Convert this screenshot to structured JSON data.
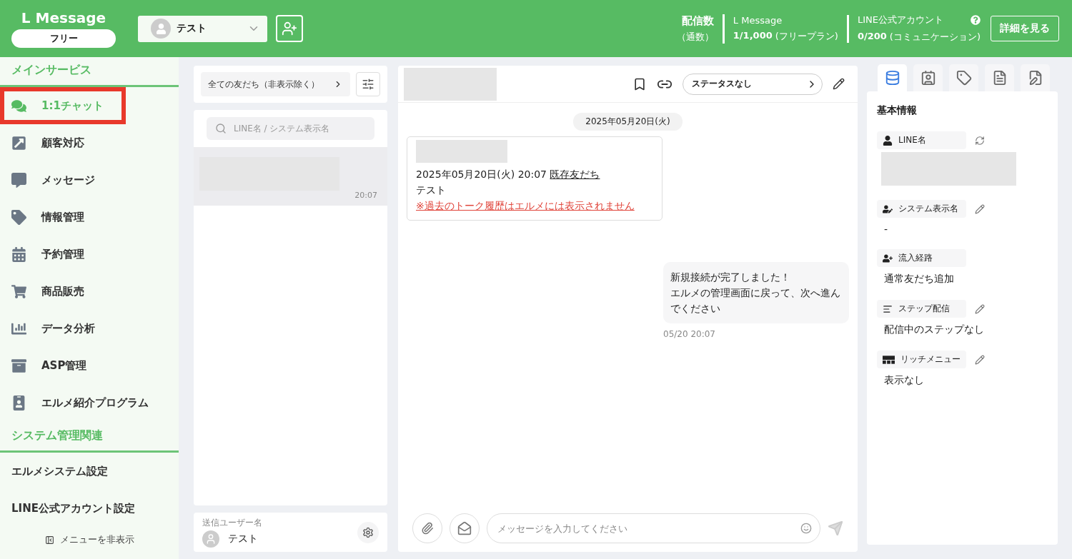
{
  "header": {
    "logo": "L Message",
    "plan_badge": "フリー",
    "account_select": {
      "value": "テスト"
    },
    "stats_label": "配信数",
    "stats_sublabel": "（通数）",
    "stats": [
      {
        "title": "L Message",
        "value": "1/1,000",
        "note": "(フリープラン)",
        "help": false
      },
      {
        "title": "LINE公式アカウント",
        "value": "0/200",
        "note": "(コミュニケーション)",
        "help": true
      }
    ],
    "details_button": "詳細を見る"
  },
  "sidebar": {
    "sections": [
      {
        "heading": "メインサービス",
        "items": [
          {
            "label": "1:1チャット",
            "selected": true,
            "highlighted": true
          },
          {
            "label": "顧客対応",
            "selected": false,
            "highlighted": false
          },
          {
            "label": "メッセージ",
            "selected": false,
            "highlighted": false
          },
          {
            "label": "情報管理",
            "selected": false,
            "highlighted": false
          },
          {
            "label": "予約管理",
            "selected": false,
            "highlighted": false
          },
          {
            "label": "商品販売",
            "selected": false,
            "highlighted": false
          },
          {
            "label": "データ分析",
            "selected": false,
            "highlighted": false
          },
          {
            "label": "ASP管理",
            "selected": false,
            "highlighted": false
          },
          {
            "label": "エルメ紹介プログラム",
            "selected": false,
            "highlighted": false
          }
        ]
      },
      {
        "heading": "システム管理関連",
        "items": [
          {
            "label": "エルメシステム設定",
            "selected": false,
            "highlighted": false
          },
          {
            "label": "LINE公式アカウント設定",
            "selected": false,
            "highlighted": false
          }
        ]
      }
    ],
    "hide_menu": "メニューを非表示"
  },
  "friend_list": {
    "filter": "全ての友だち（非表示除く）",
    "search": {
      "placeholder": "LINE名 / システム表示名"
    },
    "rows": [
      {
        "time": "20:07",
        "selected": true
      }
    ],
    "sender": {
      "label": "送信ユーザー名",
      "name": "テスト"
    }
  },
  "chat": {
    "status": "ステータスなし",
    "date": "2025年05月20日(火)",
    "system_card": {
      "line": "2025年05月20日(火) 20:07",
      "link": "既存友だち",
      "name": "テスト",
      "warning": "※過去のトーク履歴はエルメには表示されません"
    },
    "messages": [
      {
        "lines": [
          "新規接続が完了しました！",
          "エルメの管理画面に戻って、次へ進んでください"
        ],
        "time": "05/20 20:07"
      }
    ],
    "composer": {
      "placeholder": "メッセージを入力してください"
    }
  },
  "info_panel": {
    "tabs": [
      {
        "selected": true
      },
      {
        "selected": false
      },
      {
        "selected": false
      },
      {
        "selected": false
      },
      {
        "selected": false
      }
    ],
    "title": "基本情報",
    "fields": [
      {
        "label": "LINE名",
        "kind": "refresh"
      },
      {
        "label": "システム表示名",
        "kind": "edit",
        "value": "-"
      },
      {
        "label": "流入経路",
        "kind": "plain",
        "value": "通常友だち追加"
      },
      {
        "label": "ステップ配信",
        "kind": "edit",
        "value": "配信中のステップなし"
      },
      {
        "label": "リッチメニュー",
        "kind": "edit",
        "value": "表示なし"
      }
    ]
  }
}
